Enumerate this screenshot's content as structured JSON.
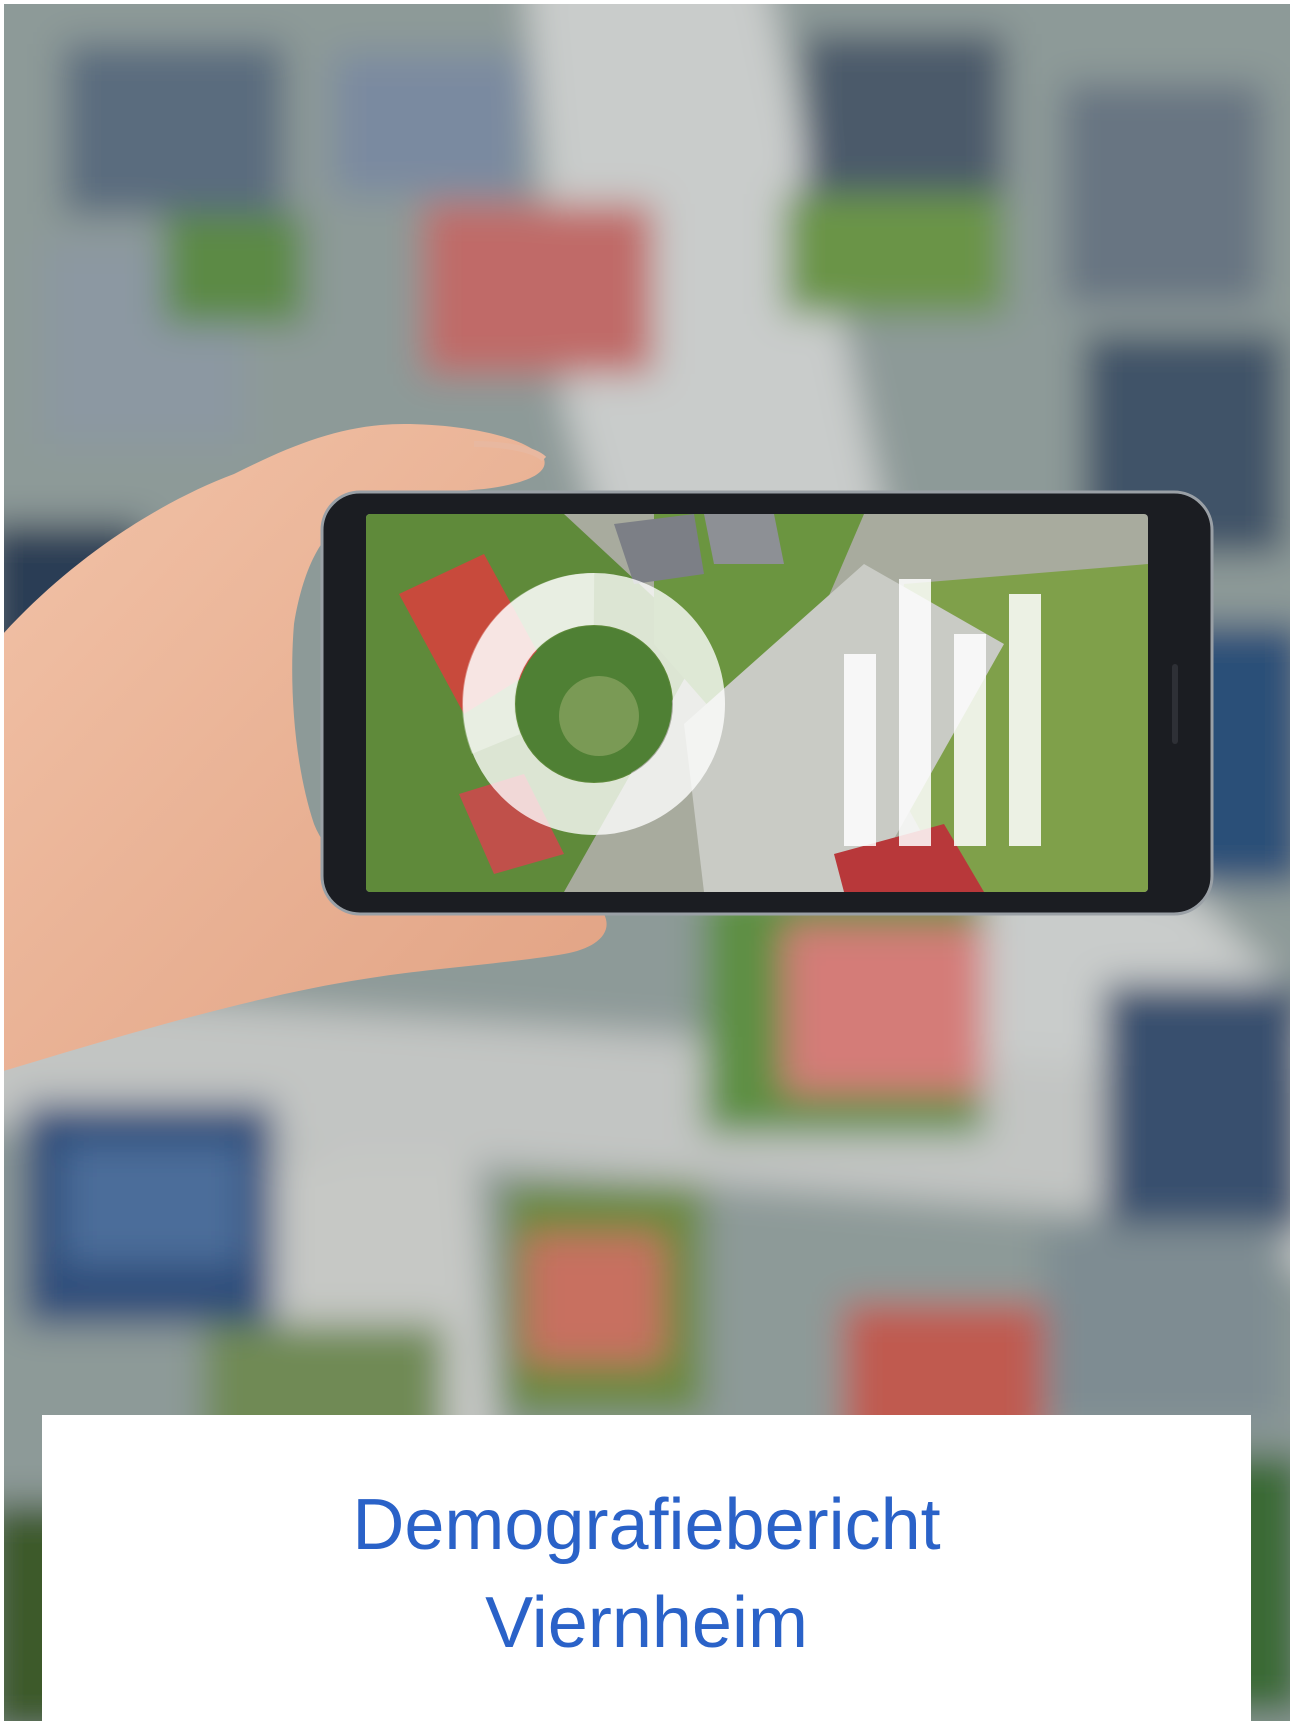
{
  "document": {
    "cover_photo": "aerial-neighborhood-photo-with-hand-holding-smartphone",
    "title_line1": "Demografiebericht",
    "title_line2": "Viernheim",
    "title_color": "#2a62c8"
  }
}
